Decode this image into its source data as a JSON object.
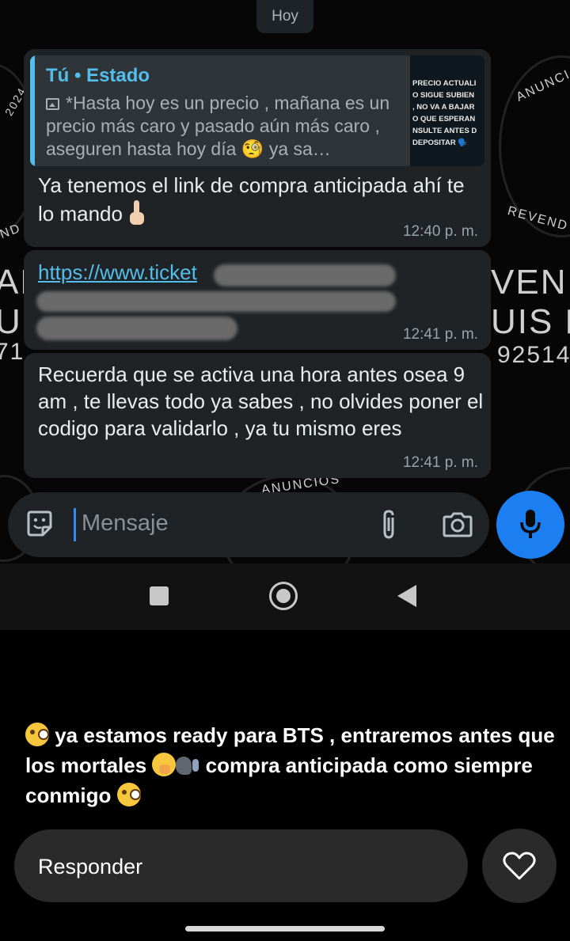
{
  "chat": {
    "date_chip": "Hoy",
    "wallpaper_fragments": [
      "AL",
      "VENDI",
      "U",
      "UIS PA",
      "71",
      "92514",
      "ANUNCI",
      "REVEND",
      "ND",
      "2024",
      "ANUNCIOS"
    ],
    "messages": [
      {
        "quoted": {
          "author": "Tú • Estado",
          "text": "*Hasta hoy es un precio , mañana es un precio más caro y pasado aún más caro , aseguren hasta hoy día 🧐 ya sa…",
          "thumbnail_lines": [
            "PRECIO ACTUALI",
            "O SIGUE SUBIEN",
            ", NO VA A BAJAR",
            "O QUE ESPERAN",
            "NSULTE ANTES D",
            "DEPOSITAR 🗣️"
          ]
        },
        "text": "Ya tenemos el link de compra anticipada ahí te lo mando",
        "emoji": "pointing-up",
        "time": "12:40 p. m."
      },
      {
        "link_text": "https://www.ticket",
        "time": "12:41 p. m."
      },
      {
        "text": "Recuerda que se activa una hora antes osea 9 am , te llevas todo ya sabes , no olvides poner el codigo para validarlo , ya tu mismo eres",
        "time": "12:41 p. m."
      }
    ],
    "composer_placeholder": "Mensaje"
  },
  "story": {
    "caption_parts": [
      " ya estamos ready para BTS , entraremos antes que los mortales ",
      " compra anticipada como siempre conmigo "
    ],
    "reply_placeholder": "Responder"
  },
  "colors": {
    "accent_blue": "#53bdeb",
    "mic_button": "#1b7ef1",
    "bubble": "#1f2326",
    "background": "#000000"
  },
  "icons": [
    "sticker-icon",
    "attach-icon",
    "camera-icon",
    "mic-icon",
    "nav-recents-icon",
    "nav-home-icon",
    "nav-back-icon",
    "heart-icon"
  ]
}
